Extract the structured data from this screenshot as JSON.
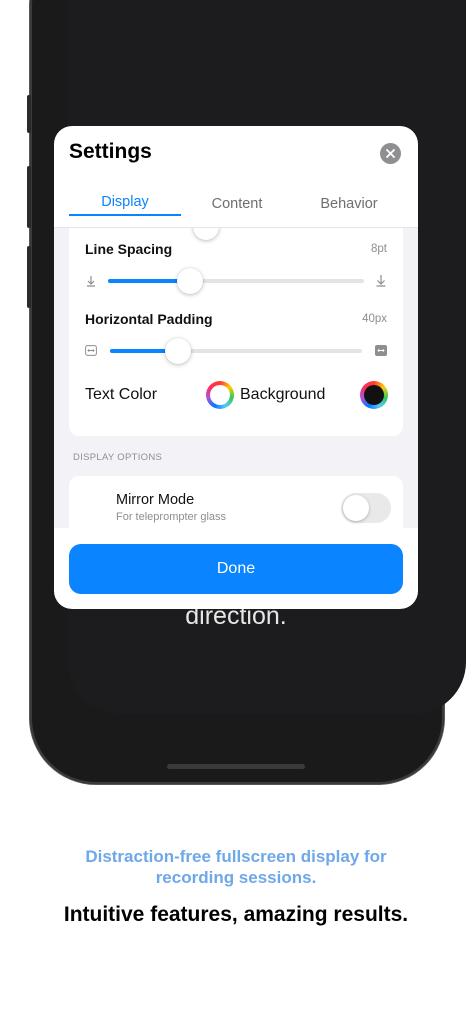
{
  "background_text": "direction.",
  "settings": {
    "title": "Settings",
    "tabs": [
      {
        "label": "Display",
        "active": true
      },
      {
        "label": "Content",
        "active": false
      },
      {
        "label": "Behavior",
        "active": false
      }
    ],
    "line_spacing": {
      "label": "Line Spacing",
      "value": "8pt",
      "level": 0.32
    },
    "horizontal_padding": {
      "label": "Horizontal Padding",
      "value": "40px",
      "level": 0.27
    },
    "text_color": {
      "label": "Text Color",
      "swatch": "#ffffff"
    },
    "background_color": {
      "label": "Background",
      "swatch": "#111111"
    },
    "display_options": {
      "header": "DISPLAY OPTIONS",
      "mirror_mode": {
        "label": "Mirror Mode",
        "sublabel": "For teleprompter glass",
        "enabled": false
      }
    },
    "done_label": "Done"
  },
  "caption": {
    "subtitle": "Distraction-free fullscreen display for recording sessions.",
    "title": "Intuitive features, amazing results."
  },
  "colors": {
    "accent": "#0a84ff",
    "caption_subtitle": "#6fa8e8"
  }
}
